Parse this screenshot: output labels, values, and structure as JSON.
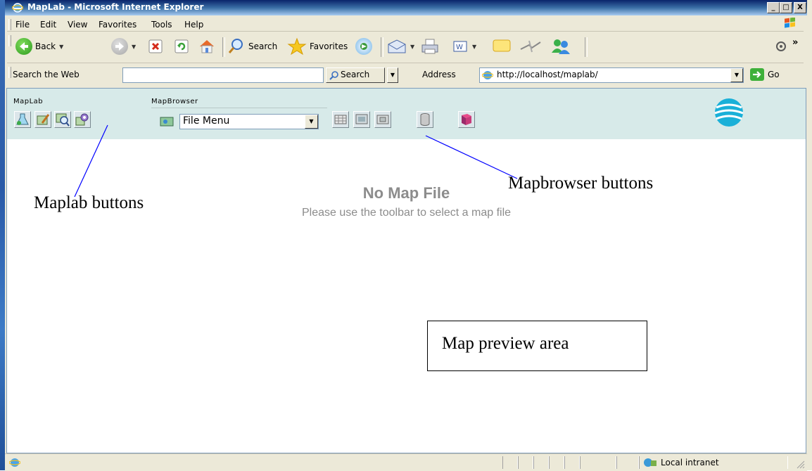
{
  "window": {
    "title": "MapLab - Microsoft Internet Explorer"
  },
  "caption_buttons": {
    "minimize": "_",
    "maximize": "□",
    "close": "X"
  },
  "menu": {
    "items": [
      "File",
      "Edit",
      "View",
      "Favorites",
      "Tools",
      "Help"
    ]
  },
  "toolbar": {
    "back_label": "Back",
    "search_label": "Search",
    "favorites_label": "Favorites",
    "chevron": "»"
  },
  "searchbar": {
    "label": "Search the Web",
    "search_value": "",
    "search_button": "Search",
    "address_label": "Address",
    "address_value": "http://localhost/maplab/",
    "go_label": "Go"
  },
  "maplab": {
    "maplab_section": "MapLab",
    "mapbrowser_section": "MapBrowser",
    "file_menu_value": "File Menu"
  },
  "content": {
    "no_map_title": "No Map File",
    "no_map_subtitle": "Please use the toolbar to select a map file"
  },
  "annotations": {
    "maplab_buttons": "Maplab buttons",
    "mapbrowser_buttons": "Mapbrowser buttons",
    "map_preview_area": "Map preview area"
  },
  "status": {
    "zone": "Local intranet"
  },
  "colors": {
    "titlebar": "#0a246a",
    "toolbar_bg": "#d7eae9",
    "chrome": "#ece9d8",
    "annotation_line": "#0000ff"
  },
  "icons": [
    "ie-logo-icon",
    "back-arrow-icon",
    "forward-arrow-icon",
    "stop-icon",
    "refresh-icon",
    "home-icon",
    "search-magnifier-icon",
    "favorites-star-icon",
    "media-icon",
    "mail-icon",
    "print-icon",
    "edit-icon",
    "discuss-icon",
    "messenger-icon",
    "globe-logo-icon"
  ]
}
